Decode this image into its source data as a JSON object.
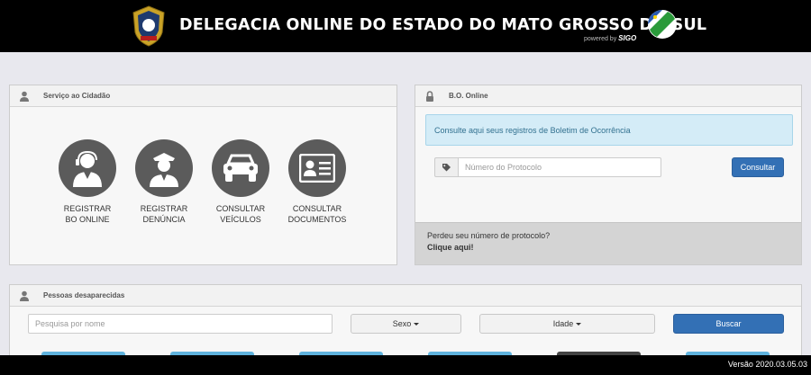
{
  "header": {
    "title": "DELEGACIA ONLINE DO ESTADO DO MATO GROSSO DO SUL",
    "powered_prefix": "powered by",
    "powered_brand": "SIGO"
  },
  "servico": {
    "title": "Serviço ao Cidadão",
    "items": [
      {
        "label": "REGISTRAR\nBO ONLINE",
        "icon": "operator-icon"
      },
      {
        "label": "REGISTRAR\nDENÚNCIA",
        "icon": "police-officer-icon"
      },
      {
        "label": "CONSULTAR\nVEÍCULOS",
        "icon": "car-icon"
      },
      {
        "label": "CONSULTAR\nDOCUMENTOS",
        "icon": "id-card-icon"
      }
    ]
  },
  "bo": {
    "title": "B.O. Online",
    "alert": "Consulte aqui seus registros de Boletim de Ocorrência",
    "protocol_placeholder": "Número do Protocolo",
    "button": "Consultar",
    "lost_text": "Perdeu seu número de protocolo?",
    "lost_link": "Clique aqui!"
  },
  "pessoas": {
    "title": "Pessoas desaparecidas",
    "search_placeholder": "Pesquisa por nome",
    "sexo_label": "Sexo",
    "idade_label": "Idade",
    "button": "Buscar"
  },
  "footer": {
    "version": "Versão 2020.03.05.03"
  },
  "colors": {
    "header_bg": "#000000",
    "accent_blue": "#3370b5",
    "alert_bg": "#d4ecf7",
    "icon_circle": "#5b5b5b"
  }
}
